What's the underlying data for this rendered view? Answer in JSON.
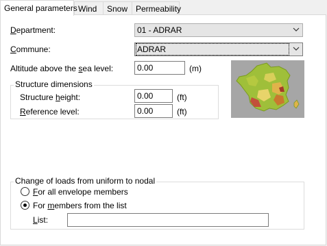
{
  "tabs": [
    {
      "label": "General parameters",
      "active": true
    },
    {
      "label": "Wind",
      "active": false
    },
    {
      "label": "Snow",
      "active": false
    },
    {
      "label": "Permeability",
      "active": false
    }
  ],
  "department": {
    "label": "Department:",
    "value": "01 - ADRAR"
  },
  "commune": {
    "label": "Commune:",
    "value": "ADRAR"
  },
  "altitude": {
    "label": "Altitude above the sea level:",
    "value": "0.00",
    "unit": "(m)"
  },
  "structure": {
    "legend": "Structure dimensions",
    "height_label": "Structure height:",
    "height_value": "0.00",
    "height_unit": "(ft)",
    "reference_label": "Reference level:",
    "reference_value": "0.00",
    "reference_unit": "(ft)"
  },
  "loads": {
    "legend": "Change of loads from uniform to nodal",
    "option_all": "For all envelope members",
    "option_list": "For members from the list",
    "selected": "list",
    "list_label": "List:",
    "list_value": ""
  },
  "icons": {
    "dropdown": "chevron-down-icon",
    "map": "france-map-icon"
  }
}
